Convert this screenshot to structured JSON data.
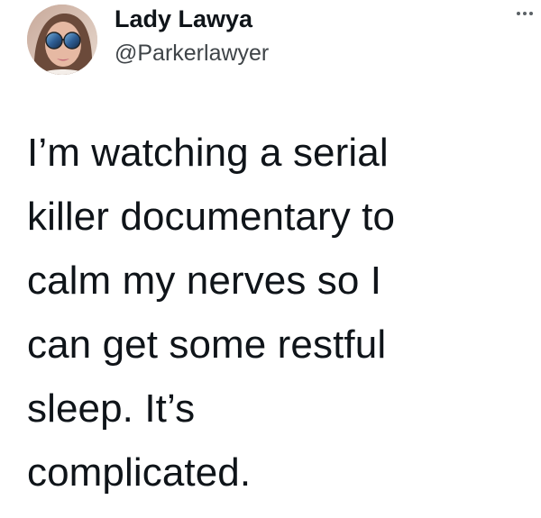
{
  "tweet": {
    "author": {
      "display_name": "Lady Lawya",
      "handle": "@Parkerlawyer",
      "avatar_icon": "profile-photo"
    },
    "more_icon": "more-horizontal-icon",
    "text_lines": [
      "I’m watching a serial",
      "killer documentary to",
      "calm my nerves so I",
      "can get some restful",
      "sleep. It’s",
      "complicated."
    ]
  },
  "colors": {
    "background": "#ffffff",
    "text_primary": "#0f1419",
    "text_secondary": "#3f4448"
  }
}
